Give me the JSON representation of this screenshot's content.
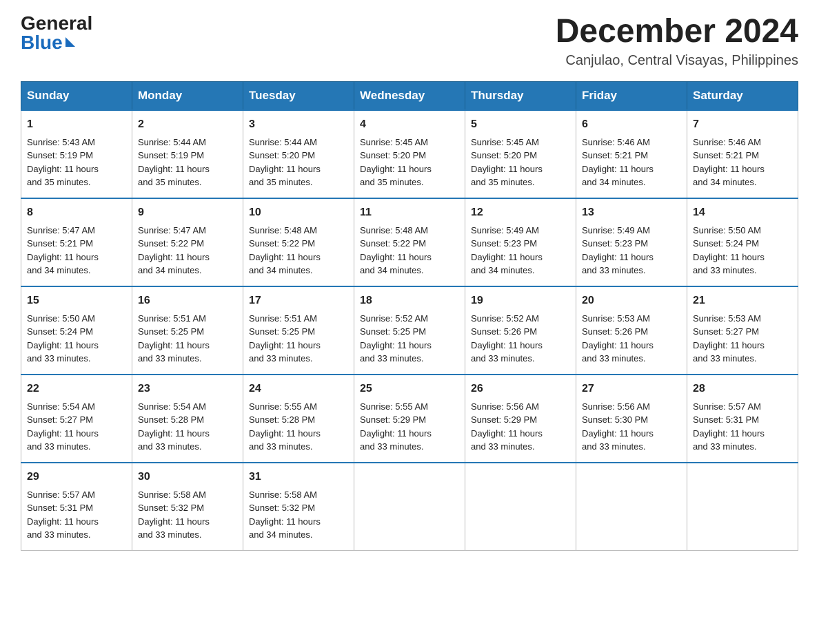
{
  "header": {
    "logo_general": "General",
    "logo_blue": "Blue",
    "title": "December 2024",
    "subtitle": "Canjulao, Central Visayas, Philippines"
  },
  "days_of_week": [
    "Sunday",
    "Monday",
    "Tuesday",
    "Wednesday",
    "Thursday",
    "Friday",
    "Saturday"
  ],
  "weeks": [
    [
      {
        "day": "1",
        "sunrise": "5:43 AM",
        "sunset": "5:19 PM",
        "daylight": "11 hours and 35 minutes."
      },
      {
        "day": "2",
        "sunrise": "5:44 AM",
        "sunset": "5:19 PM",
        "daylight": "11 hours and 35 minutes."
      },
      {
        "day": "3",
        "sunrise": "5:44 AM",
        "sunset": "5:20 PM",
        "daylight": "11 hours and 35 minutes."
      },
      {
        "day": "4",
        "sunrise": "5:45 AM",
        "sunset": "5:20 PM",
        "daylight": "11 hours and 35 minutes."
      },
      {
        "day": "5",
        "sunrise": "5:45 AM",
        "sunset": "5:20 PM",
        "daylight": "11 hours and 35 minutes."
      },
      {
        "day": "6",
        "sunrise": "5:46 AM",
        "sunset": "5:21 PM",
        "daylight": "11 hours and 34 minutes."
      },
      {
        "day": "7",
        "sunrise": "5:46 AM",
        "sunset": "5:21 PM",
        "daylight": "11 hours and 34 minutes."
      }
    ],
    [
      {
        "day": "8",
        "sunrise": "5:47 AM",
        "sunset": "5:21 PM",
        "daylight": "11 hours and 34 minutes."
      },
      {
        "day": "9",
        "sunrise": "5:47 AM",
        "sunset": "5:22 PM",
        "daylight": "11 hours and 34 minutes."
      },
      {
        "day": "10",
        "sunrise": "5:48 AM",
        "sunset": "5:22 PM",
        "daylight": "11 hours and 34 minutes."
      },
      {
        "day": "11",
        "sunrise": "5:48 AM",
        "sunset": "5:22 PM",
        "daylight": "11 hours and 34 minutes."
      },
      {
        "day": "12",
        "sunrise": "5:49 AM",
        "sunset": "5:23 PM",
        "daylight": "11 hours and 34 minutes."
      },
      {
        "day": "13",
        "sunrise": "5:49 AM",
        "sunset": "5:23 PM",
        "daylight": "11 hours and 33 minutes."
      },
      {
        "day": "14",
        "sunrise": "5:50 AM",
        "sunset": "5:24 PM",
        "daylight": "11 hours and 33 minutes."
      }
    ],
    [
      {
        "day": "15",
        "sunrise": "5:50 AM",
        "sunset": "5:24 PM",
        "daylight": "11 hours and 33 minutes."
      },
      {
        "day": "16",
        "sunrise": "5:51 AM",
        "sunset": "5:25 PM",
        "daylight": "11 hours and 33 minutes."
      },
      {
        "day": "17",
        "sunrise": "5:51 AM",
        "sunset": "5:25 PM",
        "daylight": "11 hours and 33 minutes."
      },
      {
        "day": "18",
        "sunrise": "5:52 AM",
        "sunset": "5:25 PM",
        "daylight": "11 hours and 33 minutes."
      },
      {
        "day": "19",
        "sunrise": "5:52 AM",
        "sunset": "5:26 PM",
        "daylight": "11 hours and 33 minutes."
      },
      {
        "day": "20",
        "sunrise": "5:53 AM",
        "sunset": "5:26 PM",
        "daylight": "11 hours and 33 minutes."
      },
      {
        "day": "21",
        "sunrise": "5:53 AM",
        "sunset": "5:27 PM",
        "daylight": "11 hours and 33 minutes."
      }
    ],
    [
      {
        "day": "22",
        "sunrise": "5:54 AM",
        "sunset": "5:27 PM",
        "daylight": "11 hours and 33 minutes."
      },
      {
        "day": "23",
        "sunrise": "5:54 AM",
        "sunset": "5:28 PM",
        "daylight": "11 hours and 33 minutes."
      },
      {
        "day": "24",
        "sunrise": "5:55 AM",
        "sunset": "5:28 PM",
        "daylight": "11 hours and 33 minutes."
      },
      {
        "day": "25",
        "sunrise": "5:55 AM",
        "sunset": "5:29 PM",
        "daylight": "11 hours and 33 minutes."
      },
      {
        "day": "26",
        "sunrise": "5:56 AM",
        "sunset": "5:29 PM",
        "daylight": "11 hours and 33 minutes."
      },
      {
        "day": "27",
        "sunrise": "5:56 AM",
        "sunset": "5:30 PM",
        "daylight": "11 hours and 33 minutes."
      },
      {
        "day": "28",
        "sunrise": "5:57 AM",
        "sunset": "5:31 PM",
        "daylight": "11 hours and 33 minutes."
      }
    ],
    [
      {
        "day": "29",
        "sunrise": "5:57 AM",
        "sunset": "5:31 PM",
        "daylight": "11 hours and 33 minutes."
      },
      {
        "day": "30",
        "sunrise": "5:58 AM",
        "sunset": "5:32 PM",
        "daylight": "11 hours and 33 minutes."
      },
      {
        "day": "31",
        "sunrise": "5:58 AM",
        "sunset": "5:32 PM",
        "daylight": "11 hours and 34 minutes."
      },
      null,
      null,
      null,
      null
    ]
  ],
  "labels": {
    "sunrise": "Sunrise:",
    "sunset": "Sunset:",
    "daylight": "Daylight:"
  }
}
